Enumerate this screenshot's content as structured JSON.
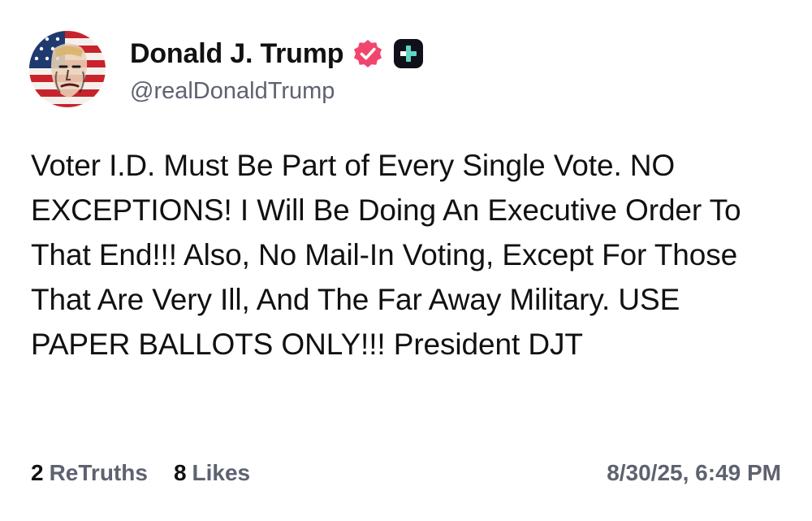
{
  "author": {
    "display_name": "Donald J. Trump",
    "handle": "@realDonaldTrump",
    "avatar_icon": "flag-portrait-avatar",
    "verified_icon": "verified-check-icon",
    "plus_badge_icon": "truth-plus-icon"
  },
  "post": {
    "text": "Voter I.D. Must Be Part of Every Single Vote. NO EXCEPTIONS! I Will Be Doing An Executive Order To That End!!! Also, No Mail-In Voting, Except For Those That Are Very Ill, And The Far Away Military. USE PAPER BALLOTS ONLY!!! President DJT"
  },
  "stats": {
    "retruths_count": "2",
    "retruths_label": "ReTruths",
    "likes_count": "8",
    "likes_label": "Likes"
  },
  "timestamp": "8/30/25, 6:49 PM",
  "colors": {
    "verified_badge": "#f0466e",
    "plus_badge_bg": "#101018",
    "plus_badge_fg": "#5fd6c6",
    "secondary_text": "#5e6270"
  }
}
